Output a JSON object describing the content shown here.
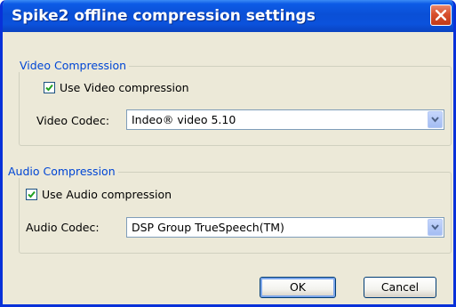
{
  "window": {
    "title": "Spike2 offline compression settings"
  },
  "video": {
    "group_label": "Video Compression",
    "checkbox_label": "Use Video compression",
    "checked": true,
    "codec_label": "Video Codec:",
    "codec_value": "Indeo® video 5.10"
  },
  "audio": {
    "group_label": "Audio Compression",
    "checkbox_label": "Use Audio compression",
    "checked": true,
    "codec_label": "Audio Codec:",
    "codec_value": "DSP Group TrueSpeech(TM)"
  },
  "buttons": {
    "ok": "OK",
    "cancel": "Cancel"
  },
  "icons": {
    "close": "close-icon",
    "checkmark": "checkmark-icon",
    "dropdown": "chevron-down-icon"
  },
  "colors": {
    "titlebar": "#0a4fd6",
    "close_button": "#d8502e",
    "group_label": "#0046d5",
    "dialog_background": "#ece9d8"
  }
}
